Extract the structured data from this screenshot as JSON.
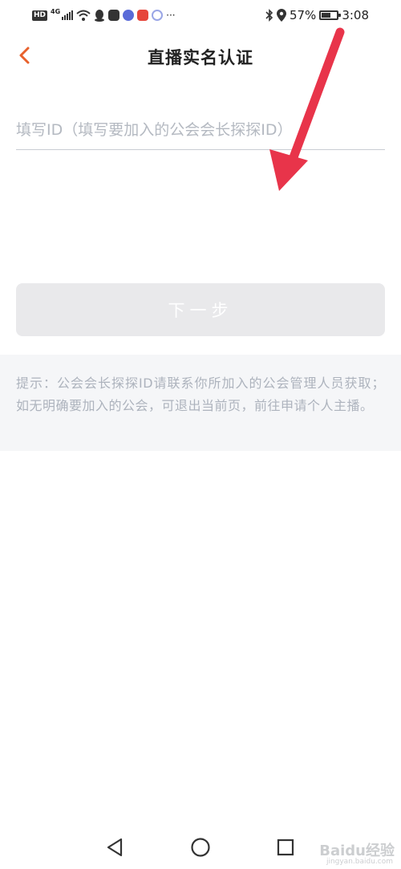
{
  "status_bar": {
    "network_badge": "HD",
    "network_type": "4G",
    "battery_percent": "57%",
    "battery_level": 0.57,
    "time": "3:08",
    "notification_icons": [
      "qq-icon",
      "app-icon-robot",
      "music-icon",
      "news-app-icon",
      "browser-icon"
    ]
  },
  "header": {
    "title": "直播实名认证"
  },
  "form": {
    "id_placeholder": "填写ID（填写要加入的公会会长探探ID）",
    "id_value": "",
    "next_label": "下一步"
  },
  "tip": {
    "text": "提示：公会会长探探ID请联系你所加入的公会管理人员获取；如无明确要加入的公会，可退出当前页，前往申请个人主播。"
  },
  "watermark": {
    "brand": "Baidu经验",
    "url": "jingyan.baidu.com"
  },
  "colors": {
    "accent": "#e8612c",
    "annotation_arrow": "#e8344a",
    "button_disabled_bg": "#e9e9eb",
    "tip_bg": "#f5f6f8"
  }
}
